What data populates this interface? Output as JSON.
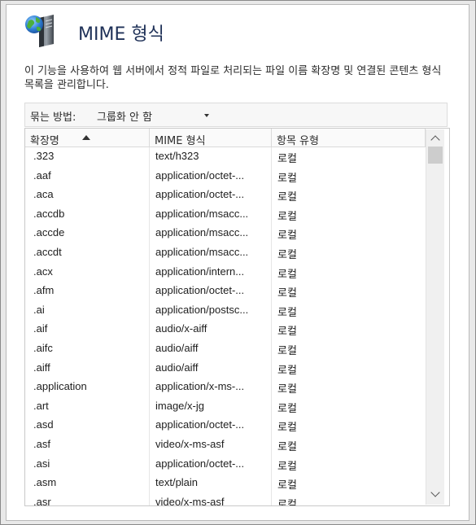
{
  "header": {
    "title": "MIME 형식",
    "icon": "mime-types-icon"
  },
  "description": "이 기능을 사용하여 웹 서버에서 정적 파일로 처리되는 파일 이름 확장명 및 연결된 콘텐츠 형식 목록을 관리합니다.",
  "group_by": {
    "label": "묶는 방법:",
    "value": "그룹화 안 함"
  },
  "table": {
    "columns": [
      "확장명",
      "MIME 형식",
      "항목 유형"
    ],
    "sorted_column": "확장명",
    "rows": [
      {
        "ext": ".323",
        "mime": "text/h323",
        "type": "로컬"
      },
      {
        "ext": ".aaf",
        "mime": "application/octet-...",
        "type": "로컬"
      },
      {
        "ext": ".aca",
        "mime": "application/octet-...",
        "type": "로컬"
      },
      {
        "ext": ".accdb",
        "mime": "application/msacc...",
        "type": "로컬"
      },
      {
        "ext": ".accde",
        "mime": "application/msacc...",
        "type": "로컬"
      },
      {
        "ext": ".accdt",
        "mime": "application/msacc...",
        "type": "로컬"
      },
      {
        "ext": ".acx",
        "mime": "application/intern...",
        "type": "로컬"
      },
      {
        "ext": ".afm",
        "mime": "application/octet-...",
        "type": "로컬"
      },
      {
        "ext": ".ai",
        "mime": "application/postsc...",
        "type": "로컬"
      },
      {
        "ext": ".aif",
        "mime": "audio/x-aiff",
        "type": "로컬"
      },
      {
        "ext": ".aifc",
        "mime": "audio/aiff",
        "type": "로컬"
      },
      {
        "ext": ".aiff",
        "mime": "audio/aiff",
        "type": "로컬"
      },
      {
        "ext": ".application",
        "mime": "application/x-ms-...",
        "type": "로컬"
      },
      {
        "ext": ".art",
        "mime": "image/x-jg",
        "type": "로컬"
      },
      {
        "ext": ".asd",
        "mime": "application/octet-...",
        "type": "로컬"
      },
      {
        "ext": ".asf",
        "mime": "video/x-ms-asf",
        "type": "로컬"
      },
      {
        "ext": ".asi",
        "mime": "application/octet-...",
        "type": "로컬"
      },
      {
        "ext": ".asm",
        "mime": "text/plain",
        "type": "로컬"
      },
      {
        "ext": ".asr",
        "mime": "video/x-ms-asf",
        "type": "로컬"
      }
    ]
  },
  "colors": {
    "title": "#1e3057",
    "selected_row": "#ffffff"
  }
}
